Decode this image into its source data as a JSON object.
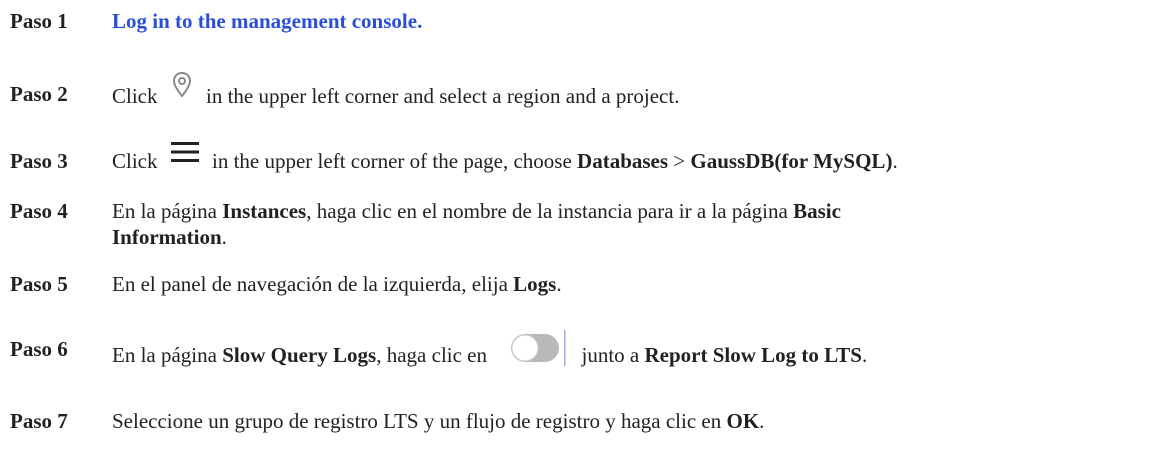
{
  "steps": [
    {
      "label": "Paso 1",
      "link_text": "Log in to the management console."
    },
    {
      "label": "Paso 2",
      "before_icon": "Click",
      "icon": "location-pin-icon",
      "after_icon": "in the upper left corner and select a region and a project."
    },
    {
      "label": "Paso 3",
      "before_icon": "Click",
      "icon": "hamburger-menu-icon",
      "after_icon": "in the upper left corner of the page, choose",
      "bold1": "Databases",
      "sep": ">",
      "bold2": "GaussDB(for MySQL)",
      "end": "."
    },
    {
      "label": "Paso 4",
      "text1": "En la página",
      "bold1": "Instances",
      "text2": ", haga clic en el nombre de la instancia para ir a la página",
      "bold2": "Basic Information",
      "end": "."
    },
    {
      "label": "Paso 5",
      "text1": "En el panel de navegación de la izquierda, elija",
      "bold1": "Logs",
      "end": "."
    },
    {
      "label": "Paso 6",
      "text1": "En la página",
      "bold1": "Slow Query Logs",
      "text2": ", haga clic en",
      "icon": "toggle-switch-icon",
      "text3": "junto a",
      "bold2": "Report Slow Log to LTS",
      "end": "."
    },
    {
      "label": "Paso 7",
      "text1": "Seleccione un grupo de registro LTS y un flujo de registro y haga clic en",
      "bold1": "OK",
      "end": "."
    }
  ]
}
